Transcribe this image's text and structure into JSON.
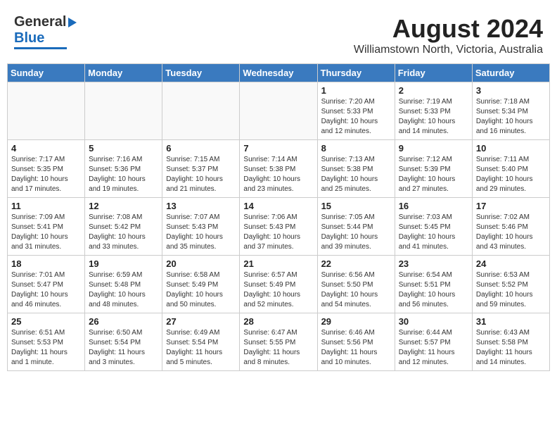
{
  "header": {
    "logo_general": "General",
    "logo_blue": "Blue",
    "main_title": "August 2024",
    "sub_title": "Williamstown North, Victoria, Australia"
  },
  "calendar": {
    "days_of_week": [
      "Sunday",
      "Monday",
      "Tuesday",
      "Wednesday",
      "Thursday",
      "Friday",
      "Saturday"
    ],
    "weeks": [
      [
        {
          "day": "",
          "info": ""
        },
        {
          "day": "",
          "info": ""
        },
        {
          "day": "",
          "info": ""
        },
        {
          "day": "",
          "info": ""
        },
        {
          "day": "1",
          "info": "Sunrise: 7:20 AM\nSunset: 5:33 PM\nDaylight: 10 hours\nand 12 minutes."
        },
        {
          "day": "2",
          "info": "Sunrise: 7:19 AM\nSunset: 5:33 PM\nDaylight: 10 hours\nand 14 minutes."
        },
        {
          "day": "3",
          "info": "Sunrise: 7:18 AM\nSunset: 5:34 PM\nDaylight: 10 hours\nand 16 minutes."
        }
      ],
      [
        {
          "day": "4",
          "info": "Sunrise: 7:17 AM\nSunset: 5:35 PM\nDaylight: 10 hours\nand 17 minutes."
        },
        {
          "day": "5",
          "info": "Sunrise: 7:16 AM\nSunset: 5:36 PM\nDaylight: 10 hours\nand 19 minutes."
        },
        {
          "day": "6",
          "info": "Sunrise: 7:15 AM\nSunset: 5:37 PM\nDaylight: 10 hours\nand 21 minutes."
        },
        {
          "day": "7",
          "info": "Sunrise: 7:14 AM\nSunset: 5:38 PM\nDaylight: 10 hours\nand 23 minutes."
        },
        {
          "day": "8",
          "info": "Sunrise: 7:13 AM\nSunset: 5:38 PM\nDaylight: 10 hours\nand 25 minutes."
        },
        {
          "day": "9",
          "info": "Sunrise: 7:12 AM\nSunset: 5:39 PM\nDaylight: 10 hours\nand 27 minutes."
        },
        {
          "day": "10",
          "info": "Sunrise: 7:11 AM\nSunset: 5:40 PM\nDaylight: 10 hours\nand 29 minutes."
        }
      ],
      [
        {
          "day": "11",
          "info": "Sunrise: 7:09 AM\nSunset: 5:41 PM\nDaylight: 10 hours\nand 31 minutes."
        },
        {
          "day": "12",
          "info": "Sunrise: 7:08 AM\nSunset: 5:42 PM\nDaylight: 10 hours\nand 33 minutes."
        },
        {
          "day": "13",
          "info": "Sunrise: 7:07 AM\nSunset: 5:43 PM\nDaylight: 10 hours\nand 35 minutes."
        },
        {
          "day": "14",
          "info": "Sunrise: 7:06 AM\nSunset: 5:43 PM\nDaylight: 10 hours\nand 37 minutes."
        },
        {
          "day": "15",
          "info": "Sunrise: 7:05 AM\nSunset: 5:44 PM\nDaylight: 10 hours\nand 39 minutes."
        },
        {
          "day": "16",
          "info": "Sunrise: 7:03 AM\nSunset: 5:45 PM\nDaylight: 10 hours\nand 41 minutes."
        },
        {
          "day": "17",
          "info": "Sunrise: 7:02 AM\nSunset: 5:46 PM\nDaylight: 10 hours\nand 43 minutes."
        }
      ],
      [
        {
          "day": "18",
          "info": "Sunrise: 7:01 AM\nSunset: 5:47 PM\nDaylight: 10 hours\nand 46 minutes."
        },
        {
          "day": "19",
          "info": "Sunrise: 6:59 AM\nSunset: 5:48 PM\nDaylight: 10 hours\nand 48 minutes."
        },
        {
          "day": "20",
          "info": "Sunrise: 6:58 AM\nSunset: 5:49 PM\nDaylight: 10 hours\nand 50 minutes."
        },
        {
          "day": "21",
          "info": "Sunrise: 6:57 AM\nSunset: 5:49 PM\nDaylight: 10 hours\nand 52 minutes."
        },
        {
          "day": "22",
          "info": "Sunrise: 6:56 AM\nSunset: 5:50 PM\nDaylight: 10 hours\nand 54 minutes."
        },
        {
          "day": "23",
          "info": "Sunrise: 6:54 AM\nSunset: 5:51 PM\nDaylight: 10 hours\nand 56 minutes."
        },
        {
          "day": "24",
          "info": "Sunrise: 6:53 AM\nSunset: 5:52 PM\nDaylight: 10 hours\nand 59 minutes."
        }
      ],
      [
        {
          "day": "25",
          "info": "Sunrise: 6:51 AM\nSunset: 5:53 PM\nDaylight: 11 hours\nand 1 minute."
        },
        {
          "day": "26",
          "info": "Sunrise: 6:50 AM\nSunset: 5:54 PM\nDaylight: 11 hours\nand 3 minutes."
        },
        {
          "day": "27",
          "info": "Sunrise: 6:49 AM\nSunset: 5:54 PM\nDaylight: 11 hours\nand 5 minutes."
        },
        {
          "day": "28",
          "info": "Sunrise: 6:47 AM\nSunset: 5:55 PM\nDaylight: 11 hours\nand 8 minutes."
        },
        {
          "day": "29",
          "info": "Sunrise: 6:46 AM\nSunset: 5:56 PM\nDaylight: 11 hours\nand 10 minutes."
        },
        {
          "day": "30",
          "info": "Sunrise: 6:44 AM\nSunset: 5:57 PM\nDaylight: 11 hours\nand 12 minutes."
        },
        {
          "day": "31",
          "info": "Sunrise: 6:43 AM\nSunset: 5:58 PM\nDaylight: 11 hours\nand 14 minutes."
        }
      ]
    ]
  }
}
